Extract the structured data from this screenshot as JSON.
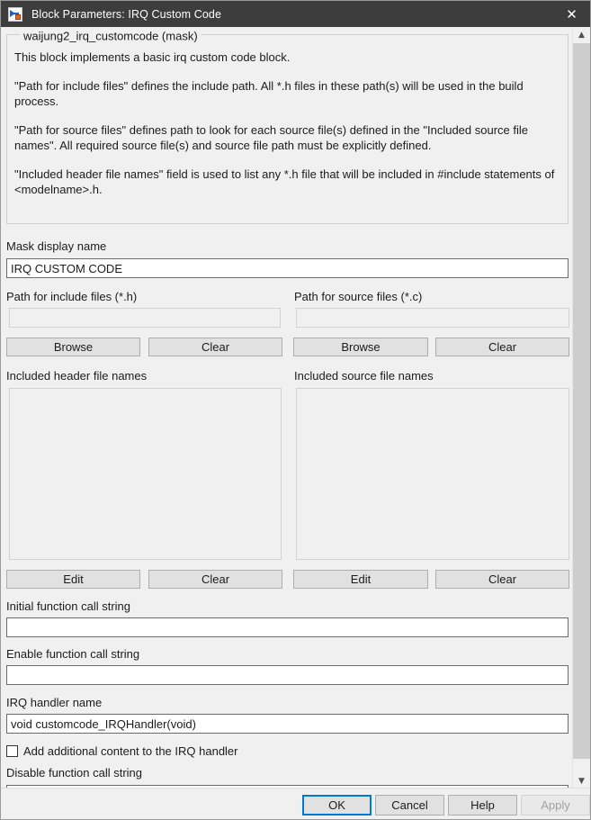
{
  "window": {
    "title": "Block Parameters: IRQ Custom Code",
    "close_label": "✕",
    "icon": "simulink-block-icon"
  },
  "mask_group": {
    "legend": "waijung2_irq_customcode (mask)",
    "paragraphs": [
      "This block implements a basic irq custom code block.",
      "\"Path for include files\" defines the include path. All *.h files in these path(s) will be used in the build process.",
      "\"Path for source files\" defines path to look for each source file(s) defined in the \"Included source file names\". All required source file(s) and source file path must be explicitly defined.",
      "\"Included header file names\" field is used to list any *.h file that will be included in #include statements of <modelname>.h."
    ]
  },
  "fields": {
    "mask_display_name": {
      "label": "Mask display name",
      "value": "IRQ CUSTOM CODE"
    },
    "path_include": {
      "label": "Path for include files (*.h)",
      "value": "",
      "browse_label": "Browse",
      "clear_label": "Clear"
    },
    "path_source": {
      "label": "Path for source files (*.c)",
      "value": "",
      "browse_label": "Browse",
      "clear_label": "Clear"
    },
    "included_header": {
      "label": "Included header file names",
      "value": "",
      "edit_label": "Edit",
      "clear_label": "Clear"
    },
    "included_source": {
      "label": "Included source file names",
      "value": "",
      "edit_label": "Edit",
      "clear_label": "Clear"
    },
    "initial_function_call": {
      "label": "Initial function call string",
      "value": ""
    },
    "enable_function_call": {
      "label": "Enable function call string",
      "value": ""
    },
    "irq_handler_name": {
      "label": "IRQ handler name",
      "value": "void customcode_IRQHandler(void)"
    },
    "add_additional_content": {
      "label": "Add additional content to the IRQ handler",
      "checked": false
    },
    "disable_function_call": {
      "label": "Disable function call string",
      "value": ""
    }
  },
  "scrollbar": {
    "up_glyph": "▲",
    "down_glyph": "▼"
  },
  "footer": {
    "ok_label": "OK",
    "cancel_label": "Cancel",
    "help_label": "Help",
    "apply_label": "Apply"
  },
  "colors": {
    "titlebar": "#3d3d3d",
    "dialog_bg": "#f0f0f0",
    "accent": "#0078d7",
    "text": "#1b1b1b",
    "disabled_text": "#a0a0a0"
  }
}
